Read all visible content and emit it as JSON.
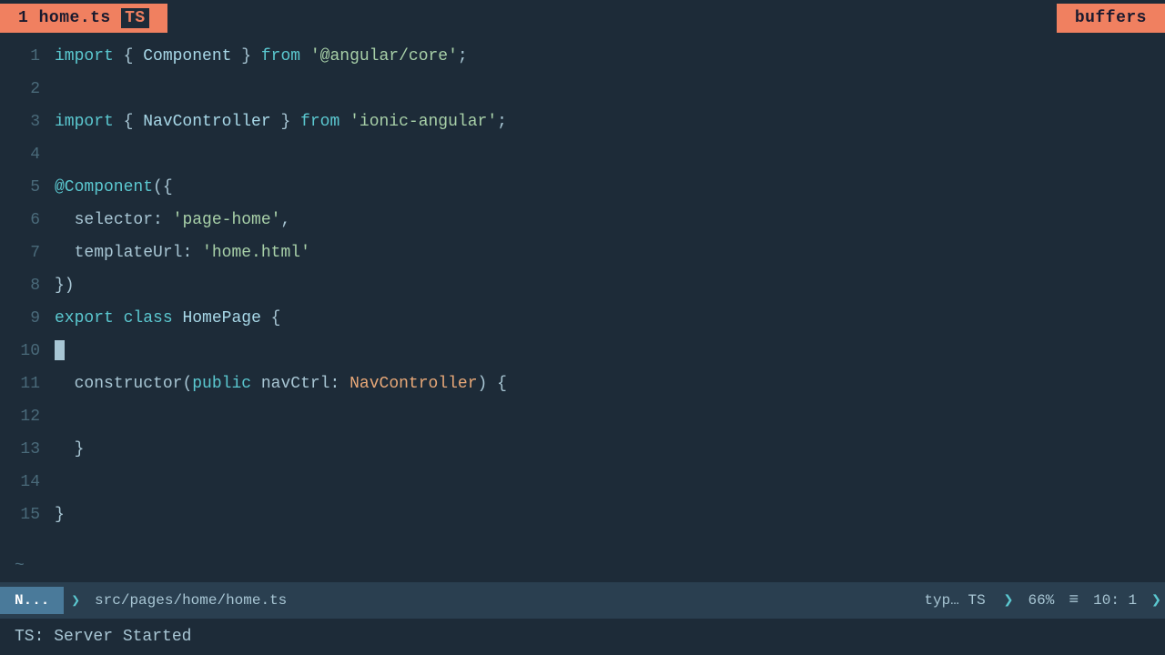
{
  "tab": {
    "number": "1",
    "filename": "home.ts",
    "badge": "TS"
  },
  "buffers_label": "buffers",
  "code": {
    "lines": [
      {
        "num": 1,
        "tokens": [
          {
            "t": "kw-import",
            "v": "import"
          },
          {
            "t": "plain",
            "v": " { "
          },
          {
            "t": "class-name",
            "v": "Component"
          },
          {
            "t": "plain",
            "v": " } "
          },
          {
            "t": "kw-from",
            "v": "from"
          },
          {
            "t": "plain",
            "v": " "
          },
          {
            "t": "str",
            "v": "'@angular/core'"
          },
          {
            "t": "plain",
            "v": ";"
          }
        ]
      },
      {
        "num": 2,
        "tokens": []
      },
      {
        "num": 3,
        "tokens": [
          {
            "t": "kw-import",
            "v": "import"
          },
          {
            "t": "plain",
            "v": " { "
          },
          {
            "t": "class-name",
            "v": "NavController"
          },
          {
            "t": "plain",
            "v": " } "
          },
          {
            "t": "kw-from",
            "v": "from"
          },
          {
            "t": "plain",
            "v": " "
          },
          {
            "t": "str",
            "v": "'ionic-angular'"
          },
          {
            "t": "plain",
            "v": ";"
          }
        ]
      },
      {
        "num": 4,
        "tokens": []
      },
      {
        "num": 5,
        "tokens": [
          {
            "t": "decorator",
            "v": "@Component"
          },
          {
            "t": "plain",
            "v": "({"
          }
        ]
      },
      {
        "num": 6,
        "tokens": [
          {
            "t": "plain",
            "v": "  "
          },
          {
            "t": "prop",
            "v": "selector"
          },
          {
            "t": "plain",
            "v": ": "
          },
          {
            "t": "str",
            "v": "'page-home'"
          },
          {
            "t": "plain",
            "v": ","
          }
        ]
      },
      {
        "num": 7,
        "tokens": [
          {
            "t": "plain",
            "v": "  "
          },
          {
            "t": "prop",
            "v": "templateUrl"
          },
          {
            "t": "plain",
            "v": ": "
          },
          {
            "t": "str",
            "v": "'home.html'"
          }
        ]
      },
      {
        "num": 8,
        "tokens": [
          {
            "t": "plain",
            "v": "})"
          }
        ]
      },
      {
        "num": 9,
        "tokens": [
          {
            "t": "kw-export",
            "v": "export"
          },
          {
            "t": "plain",
            "v": " "
          },
          {
            "t": "kw-class",
            "v": "class"
          },
          {
            "t": "plain",
            "v": " "
          },
          {
            "t": "class-name",
            "v": "HomePage"
          },
          {
            "t": "plain",
            "v": " {"
          }
        ]
      },
      {
        "num": 10,
        "tokens": [],
        "cursor": true
      },
      {
        "num": 11,
        "tokens": [
          {
            "t": "plain",
            "v": "  "
          },
          {
            "t": "func",
            "v": "constructor"
          },
          {
            "t": "plain",
            "v": "("
          },
          {
            "t": "kw-public",
            "v": "public"
          },
          {
            "t": "plain",
            "v": " "
          },
          {
            "t": "prop",
            "v": "navCtrl"
          },
          {
            "t": "plain",
            "v": ": "
          },
          {
            "t": "type-name",
            "v": "NavController"
          },
          {
            "t": "plain",
            "v": ") {"
          }
        ]
      },
      {
        "num": 12,
        "tokens": []
      },
      {
        "num": 13,
        "tokens": [
          {
            "t": "plain",
            "v": "  }"
          }
        ]
      },
      {
        "num": 14,
        "tokens": []
      },
      {
        "num": 15,
        "tokens": [
          {
            "t": "plain",
            "v": "}"
          }
        ]
      }
    ]
  },
  "status": {
    "mode": "N...",
    "filepath": "src/pages/home/home.ts",
    "filetype": "typ… TS",
    "zoom": "66%",
    "position": "10:   1",
    "ts_badge": "TS"
  },
  "message": "TS: Server Started"
}
